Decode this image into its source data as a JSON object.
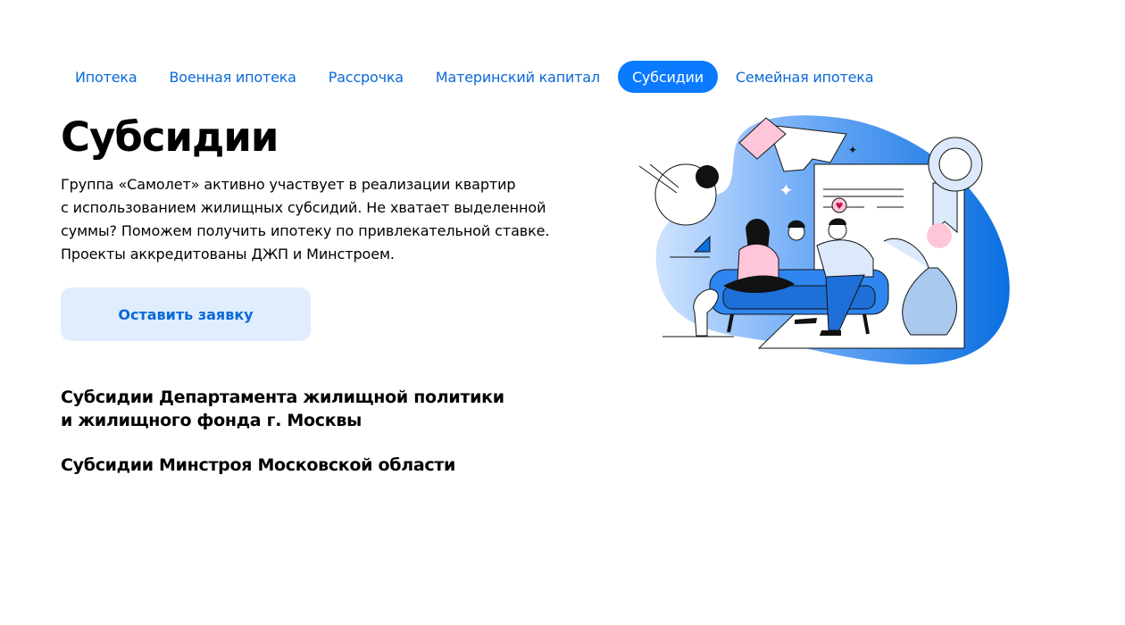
{
  "tabs": [
    {
      "label": "Ипотека",
      "active": false
    },
    {
      "label": "Военная ипотека",
      "active": false
    },
    {
      "label": "Рассрочка",
      "active": false
    },
    {
      "label": "Материнский капитал",
      "active": false
    },
    {
      "label": "Субсидии",
      "active": true
    },
    {
      "label": "Семейная ипотека",
      "active": false
    }
  ],
  "hero": {
    "title": "Субсидии",
    "description_lines": [
      "Группа «Самолет» активно участвует в реализации квартир",
      "с использованием жилищных субсидий. Не хватает выделенной",
      "суммы? Поможем получить ипотеку по привлекательной ставке.",
      "Проекты аккредитованы ДЖП и Минстроем."
    ],
    "cta_label": "Оставить заявку"
  },
  "sections": [
    {
      "title_lines": [
        "Субсидии Департамента жилищной политики",
        "и жилищного фонда г. Москвы"
      ]
    },
    {
      "title_lines": [
        "Субсидии Минстроя Московской области"
      ]
    }
  ],
  "colors": {
    "accent": "#0a7aff",
    "link": "#0a69d6",
    "cta_bg": "#e0edfc"
  },
  "illustration": {
    "icon": "family-on-sofa-with-certificate-illustration"
  }
}
